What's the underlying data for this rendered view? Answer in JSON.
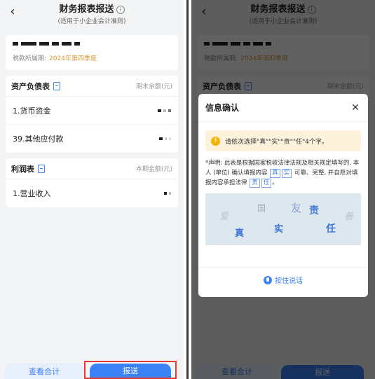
{
  "header": {
    "title": "财务报表报送",
    "info_glyph": "i",
    "subtitle": "(适用于小企业会计准则)",
    "back_icon": "chevron-left-icon"
  },
  "company": {
    "period_label": "税款所属期:",
    "period_value": "2024年第四季度"
  },
  "balance_sheet": {
    "title": "资产负债表",
    "column_label": "期末余额(元)",
    "rows": [
      {
        "label": "1.货币资金"
      },
      {
        "label": "39.其他应付款"
      }
    ]
  },
  "income_statement": {
    "title": "利润表",
    "column_label": "本期金额(元)",
    "rows": [
      {
        "label": "1.营业收入"
      }
    ]
  },
  "actions": {
    "view_label": "查看合计",
    "submit_label": "报送"
  },
  "modal": {
    "title": "信息确认",
    "close_glyph": "✕",
    "tip_glyph": "!",
    "tip_text": "请依次选择\"真\"\"实\"\"责\"\"任\"4个字。",
    "declaration_part1": "*声明: 此表是根据国家税收法律法规及相关规定填写的, 本人 (单位) 确认填报内容",
    "hl1": "真",
    "hl2": "实",
    "declaration_part2": "可靠、完整, 并自愿对填报内容承担法律",
    "hl3": "责",
    "hl4": "任",
    "declaration_end": "。",
    "captcha_chars": [
      "爱",
      "国",
      "友",
      "责",
      "善",
      "真",
      "实",
      "任"
    ],
    "voice_label": "按住说话"
  },
  "colors": {
    "accent": "#3b82f6",
    "highlight_border": "#e53935",
    "period_color": "#d59b3a",
    "tip_bg": "#fdf2dc"
  }
}
